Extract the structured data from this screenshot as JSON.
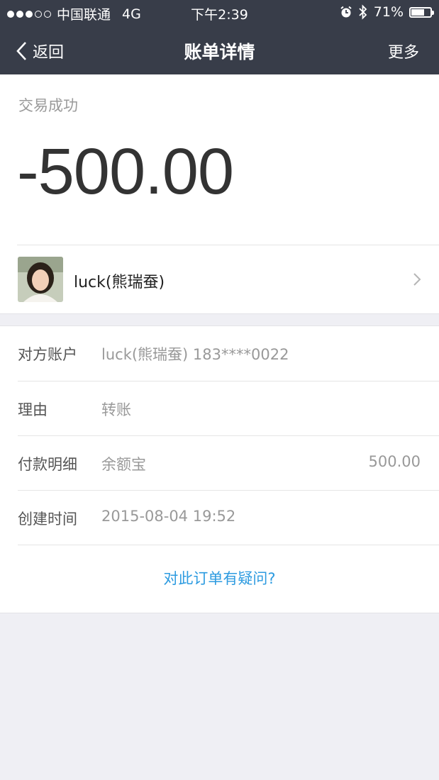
{
  "statusbar": {
    "carrier": "中国联通",
    "network": "4G",
    "time": "下午2:39",
    "battery": "71%",
    "battery_level": 0.71,
    "icons": [
      "alarm-icon",
      "bluetooth-icon",
      "battery-icon"
    ]
  },
  "navbar": {
    "back_label": "返回",
    "title": "账单详情",
    "more_label": "更多"
  },
  "summary": {
    "status": "交易成功",
    "amount": "-500.00"
  },
  "counterparty": {
    "name": "luck(熊瑞蚕)"
  },
  "details": {
    "rows": [
      {
        "label": "对方账户",
        "value": "luck(熊瑞蚕) 183****0022",
        "amount": ""
      },
      {
        "label": "理由",
        "value": "转账",
        "amount": ""
      },
      {
        "label": "付款明细",
        "value": "余额宝",
        "amount": "500.00"
      },
      {
        "label": "创建时间",
        "value": "2015-08-04 19:52",
        "amount": ""
      }
    ],
    "question_link": "对此订单有疑问?"
  },
  "colors": {
    "header_bg": "#383d49",
    "page_bg": "#efeff4",
    "link": "#2d9be0"
  }
}
